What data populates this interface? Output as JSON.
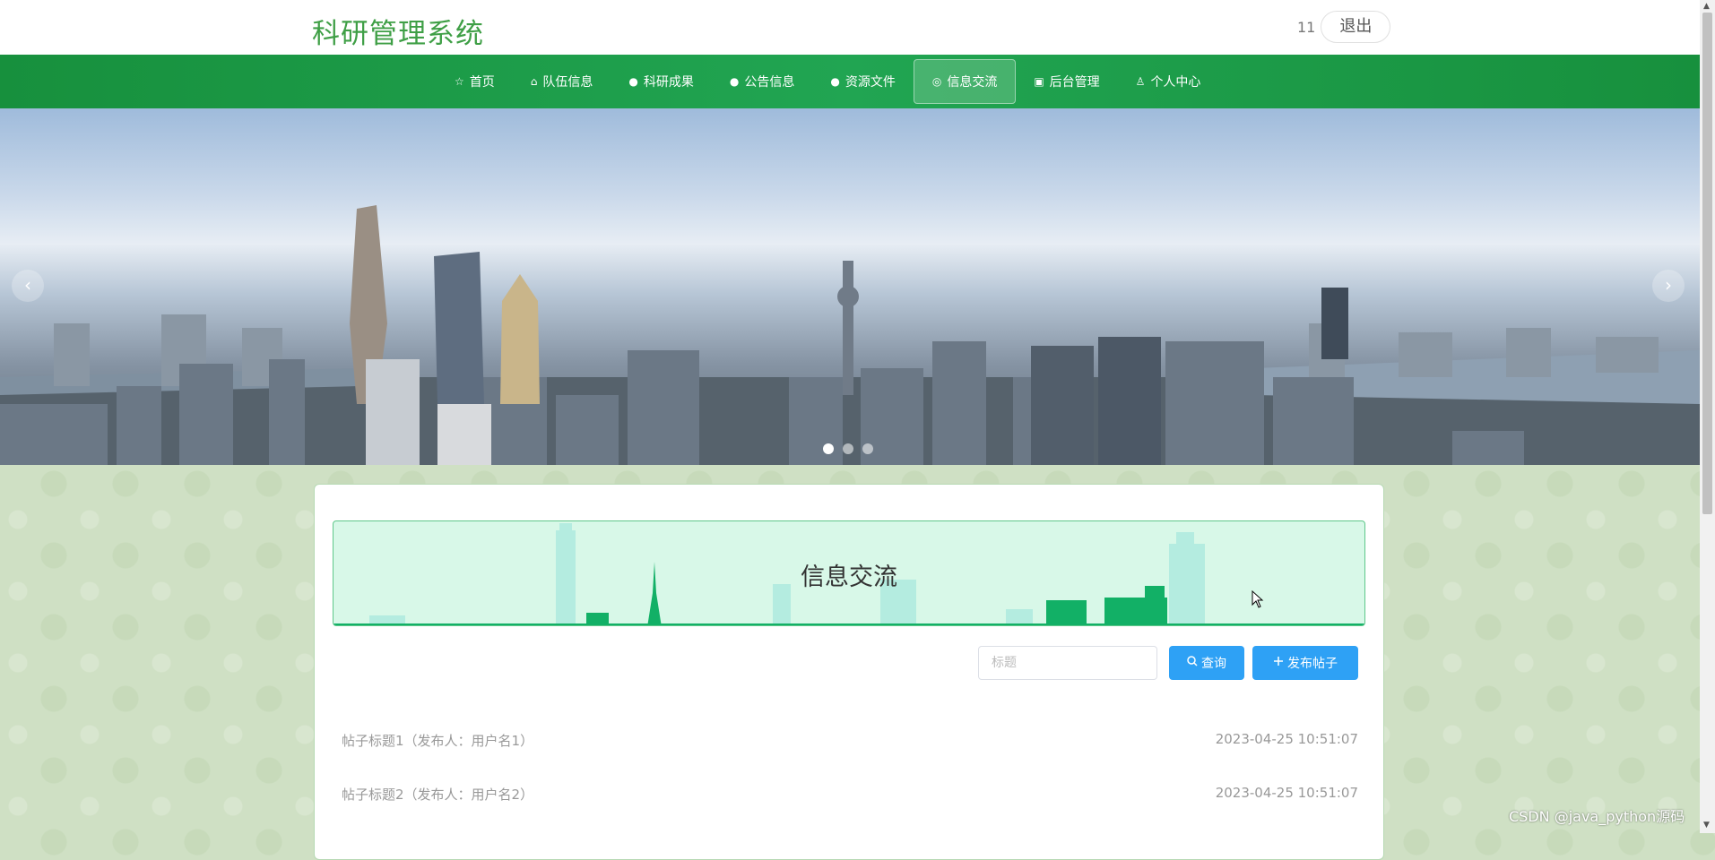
{
  "header": {
    "title": "科研管理系统",
    "username": "11",
    "logout_label": "退出"
  },
  "nav": {
    "items": [
      {
        "label": "首页",
        "icon": "star-icon",
        "glyph": "☆"
      },
      {
        "label": "队伍信息",
        "icon": "bag-icon",
        "glyph": "⌂"
      },
      {
        "label": "科研成果",
        "icon": "info-circle-icon",
        "glyph": "●"
      },
      {
        "label": "公告信息",
        "icon": "question-circle-icon",
        "glyph": "●"
      },
      {
        "label": "资源文件",
        "icon": "info-circle-icon",
        "glyph": "●"
      },
      {
        "label": "信息交流",
        "icon": "globe-icon",
        "glyph": "◎"
      },
      {
        "label": "后台管理",
        "icon": "briefcase-icon",
        "glyph": "▣"
      },
      {
        "label": "个人中心",
        "icon": "user-icon",
        "glyph": "♙"
      }
    ],
    "active_index": 5
  },
  "carousel": {
    "prev_glyph": "‹",
    "next_glyph": "›",
    "slide_count": 3,
    "active_slide": 1
  },
  "section": {
    "title": "信息交流"
  },
  "search": {
    "placeholder": "标题",
    "value": "",
    "search_button": "查询",
    "post_button": "发布帖子"
  },
  "posts": [
    {
      "title": "帖子标题1（发布人：用户名1）",
      "time": "2023-04-25 10:51:07"
    },
    {
      "title": "帖子标题2（发布人：用户名2）",
      "time": "2023-04-25 10:51:07"
    }
  ],
  "watermark": "CSDN @java_python源码",
  "colors": {
    "brand_green": "#3f9f46",
    "nav_green": "#1c9c48",
    "button_blue": "#2ea1f5",
    "banner_bg": "#d8f8e8"
  }
}
